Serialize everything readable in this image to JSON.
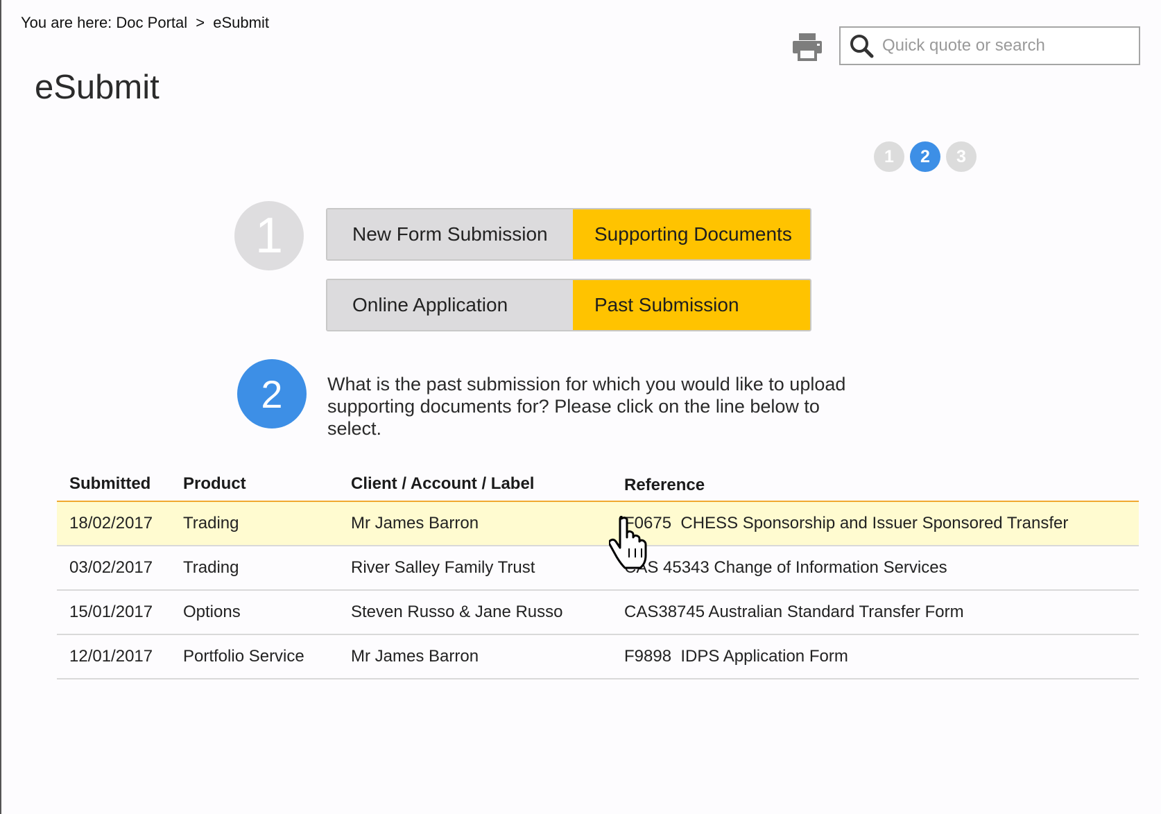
{
  "breadcrumb": {
    "prefix": "You are here:",
    "items": [
      "Doc Portal",
      "eSubmit"
    ],
    "separator": ">"
  },
  "page_title": "eSubmit",
  "search": {
    "placeholder": "Quick quote or search",
    "value": ""
  },
  "icons": {
    "print": "printer-icon",
    "search": "search-icon",
    "cursor": "hand-pointer-cursor"
  },
  "steps": {
    "items": [
      "1",
      "2",
      "3"
    ],
    "active": "2"
  },
  "step1": {
    "number": "1",
    "row1": {
      "left": "New Form Submission",
      "right": "Supporting Documents"
    },
    "row2": {
      "left": "Online Application",
      "right": "Past Submission"
    }
  },
  "step2": {
    "number": "2",
    "question": "What is the past submission for which you would like to upload supporting documents for? Please click on the line below to select."
  },
  "table": {
    "headers": [
      "Submitted",
      "Product",
      "Client / Account / Label",
      "Reference"
    ],
    "rows": [
      {
        "submitted": "18/02/2017",
        "product": "Trading",
        "client": "Mr James Barron",
        "reference": "F0675  CHESS Sponsorship and Issuer Sponsored Transfer",
        "highlighted": true
      },
      {
        "submitted": "03/02/2017",
        "product": "Trading",
        "client": "River Salley Family Trust",
        "reference": "CAS 45343 Change of Information Services",
        "highlighted": false
      },
      {
        "submitted": "15/01/2017",
        "product": "Options",
        "client": "Steven Russo & Jane Russo",
        "reference": "CAS38745 Australian Standard Transfer Form",
        "highlighted": false
      },
      {
        "submitted": "12/01/2017",
        "product": "Portfolio Service",
        "client": "Mr James Barron",
        "reference": "F9898  IDPS Application Form",
        "highlighted": false
      }
    ]
  },
  "colors": {
    "accent_blue": "#3d8fe6",
    "accent_yellow": "#ffc300",
    "inactive_grey": "#dcdbdd",
    "highlight_row": "#fffbd0",
    "header_rule": "#f0a830"
  }
}
